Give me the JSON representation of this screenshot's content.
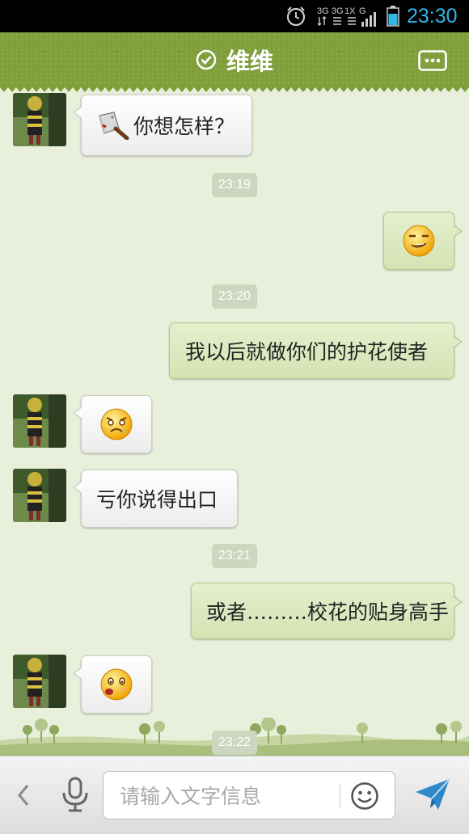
{
  "status_bar": {
    "network_label_1": "3G",
    "network_label_2": "3G",
    "network_label_3": "1X",
    "network_label_4": "G",
    "time": "23:30",
    "clock_color": "#33b5e5",
    "icons": [
      "alarm-icon",
      "network-icon",
      "signal-icon",
      "battery-icon"
    ]
  },
  "header": {
    "title": "维维",
    "online_icon": "check-circle-icon",
    "menu_icon": "more-icon",
    "color": "#7e9f3a"
  },
  "messages": [
    {
      "side": "in",
      "emoji": "cleaver-icon",
      "text": "你想怎样？"
    },
    {
      "type": "time",
      "text": "23:19"
    },
    {
      "side": "out",
      "emoji": "smirk-face-icon",
      "text": ""
    },
    {
      "type": "time",
      "text": "23:20"
    },
    {
      "side": "out",
      "text": "我以后就做你们的护花使者"
    },
    {
      "side": "in",
      "emoji": "worried-face-icon",
      "text": ""
    },
    {
      "side": "in",
      "text": "亏你说得出口"
    },
    {
      "type": "time",
      "text": "23:21"
    },
    {
      "side": "out",
      "text": "或者………校花的贴身高手"
    },
    {
      "side": "in",
      "emoji": "surprised-face-icon",
      "text": ""
    },
    {
      "type": "time",
      "text": "23:22"
    }
  ],
  "input_bar": {
    "placeholder": "请输入文字信息",
    "value": "",
    "icons": [
      "back-icon",
      "microphone-icon",
      "smiley-icon",
      "send-icon"
    ]
  }
}
